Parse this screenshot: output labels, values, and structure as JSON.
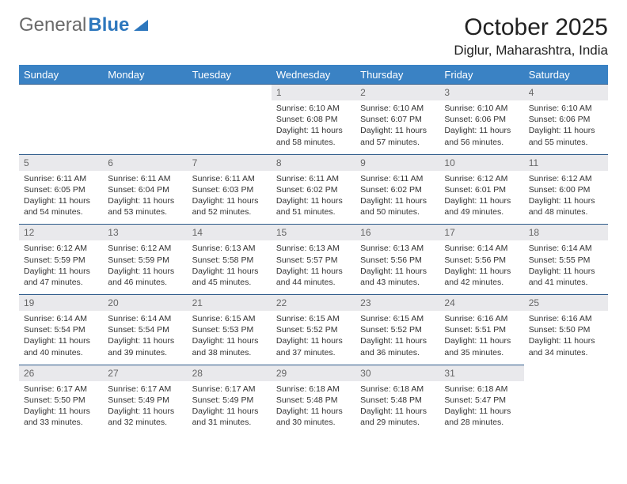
{
  "brand": {
    "part1": "General",
    "part2": "Blue"
  },
  "title": "October 2025",
  "location": "Diglur, Maharashtra, India",
  "dow": [
    "Sunday",
    "Monday",
    "Tuesday",
    "Wednesday",
    "Thursday",
    "Friday",
    "Saturday"
  ],
  "days": [
    {
      "n": "",
      "sr": "",
      "ss": "",
      "dl": ""
    },
    {
      "n": "",
      "sr": "",
      "ss": "",
      "dl": ""
    },
    {
      "n": "",
      "sr": "",
      "ss": "",
      "dl": ""
    },
    {
      "n": "1",
      "sr": "Sunrise: 6:10 AM",
      "ss": "Sunset: 6:08 PM",
      "dl": "Daylight: 11 hours and 58 minutes."
    },
    {
      "n": "2",
      "sr": "Sunrise: 6:10 AM",
      "ss": "Sunset: 6:07 PM",
      "dl": "Daylight: 11 hours and 57 minutes."
    },
    {
      "n": "3",
      "sr": "Sunrise: 6:10 AM",
      "ss": "Sunset: 6:06 PM",
      "dl": "Daylight: 11 hours and 56 minutes."
    },
    {
      "n": "4",
      "sr": "Sunrise: 6:10 AM",
      "ss": "Sunset: 6:06 PM",
      "dl": "Daylight: 11 hours and 55 minutes."
    },
    {
      "n": "5",
      "sr": "Sunrise: 6:11 AM",
      "ss": "Sunset: 6:05 PM",
      "dl": "Daylight: 11 hours and 54 minutes."
    },
    {
      "n": "6",
      "sr": "Sunrise: 6:11 AM",
      "ss": "Sunset: 6:04 PM",
      "dl": "Daylight: 11 hours and 53 minutes."
    },
    {
      "n": "7",
      "sr": "Sunrise: 6:11 AM",
      "ss": "Sunset: 6:03 PM",
      "dl": "Daylight: 11 hours and 52 minutes."
    },
    {
      "n": "8",
      "sr": "Sunrise: 6:11 AM",
      "ss": "Sunset: 6:02 PM",
      "dl": "Daylight: 11 hours and 51 minutes."
    },
    {
      "n": "9",
      "sr": "Sunrise: 6:11 AM",
      "ss": "Sunset: 6:02 PM",
      "dl": "Daylight: 11 hours and 50 minutes."
    },
    {
      "n": "10",
      "sr": "Sunrise: 6:12 AM",
      "ss": "Sunset: 6:01 PM",
      "dl": "Daylight: 11 hours and 49 minutes."
    },
    {
      "n": "11",
      "sr": "Sunrise: 6:12 AM",
      "ss": "Sunset: 6:00 PM",
      "dl": "Daylight: 11 hours and 48 minutes."
    },
    {
      "n": "12",
      "sr": "Sunrise: 6:12 AM",
      "ss": "Sunset: 5:59 PM",
      "dl": "Daylight: 11 hours and 47 minutes."
    },
    {
      "n": "13",
      "sr": "Sunrise: 6:12 AM",
      "ss": "Sunset: 5:59 PM",
      "dl": "Daylight: 11 hours and 46 minutes."
    },
    {
      "n": "14",
      "sr": "Sunrise: 6:13 AM",
      "ss": "Sunset: 5:58 PM",
      "dl": "Daylight: 11 hours and 45 minutes."
    },
    {
      "n": "15",
      "sr": "Sunrise: 6:13 AM",
      "ss": "Sunset: 5:57 PM",
      "dl": "Daylight: 11 hours and 44 minutes."
    },
    {
      "n": "16",
      "sr": "Sunrise: 6:13 AM",
      "ss": "Sunset: 5:56 PM",
      "dl": "Daylight: 11 hours and 43 minutes."
    },
    {
      "n": "17",
      "sr": "Sunrise: 6:14 AM",
      "ss": "Sunset: 5:56 PM",
      "dl": "Daylight: 11 hours and 42 minutes."
    },
    {
      "n": "18",
      "sr": "Sunrise: 6:14 AM",
      "ss": "Sunset: 5:55 PM",
      "dl": "Daylight: 11 hours and 41 minutes."
    },
    {
      "n": "19",
      "sr": "Sunrise: 6:14 AM",
      "ss": "Sunset: 5:54 PM",
      "dl": "Daylight: 11 hours and 40 minutes."
    },
    {
      "n": "20",
      "sr": "Sunrise: 6:14 AM",
      "ss": "Sunset: 5:54 PM",
      "dl": "Daylight: 11 hours and 39 minutes."
    },
    {
      "n": "21",
      "sr": "Sunrise: 6:15 AM",
      "ss": "Sunset: 5:53 PM",
      "dl": "Daylight: 11 hours and 38 minutes."
    },
    {
      "n": "22",
      "sr": "Sunrise: 6:15 AM",
      "ss": "Sunset: 5:52 PM",
      "dl": "Daylight: 11 hours and 37 minutes."
    },
    {
      "n": "23",
      "sr": "Sunrise: 6:15 AM",
      "ss": "Sunset: 5:52 PM",
      "dl": "Daylight: 11 hours and 36 minutes."
    },
    {
      "n": "24",
      "sr": "Sunrise: 6:16 AM",
      "ss": "Sunset: 5:51 PM",
      "dl": "Daylight: 11 hours and 35 minutes."
    },
    {
      "n": "25",
      "sr": "Sunrise: 6:16 AM",
      "ss": "Sunset: 5:50 PM",
      "dl": "Daylight: 11 hours and 34 minutes."
    },
    {
      "n": "26",
      "sr": "Sunrise: 6:17 AM",
      "ss": "Sunset: 5:50 PM",
      "dl": "Daylight: 11 hours and 33 minutes."
    },
    {
      "n": "27",
      "sr": "Sunrise: 6:17 AM",
      "ss": "Sunset: 5:49 PM",
      "dl": "Daylight: 11 hours and 32 minutes."
    },
    {
      "n": "28",
      "sr": "Sunrise: 6:17 AM",
      "ss": "Sunset: 5:49 PM",
      "dl": "Daylight: 11 hours and 31 minutes."
    },
    {
      "n": "29",
      "sr": "Sunrise: 6:18 AM",
      "ss": "Sunset: 5:48 PM",
      "dl": "Daylight: 11 hours and 30 minutes."
    },
    {
      "n": "30",
      "sr": "Sunrise: 6:18 AM",
      "ss": "Sunset: 5:48 PM",
      "dl": "Daylight: 11 hours and 29 minutes."
    },
    {
      "n": "31",
      "sr": "Sunrise: 6:18 AM",
      "ss": "Sunset: 5:47 PM",
      "dl": "Daylight: 11 hours and 28 minutes."
    }
  ]
}
